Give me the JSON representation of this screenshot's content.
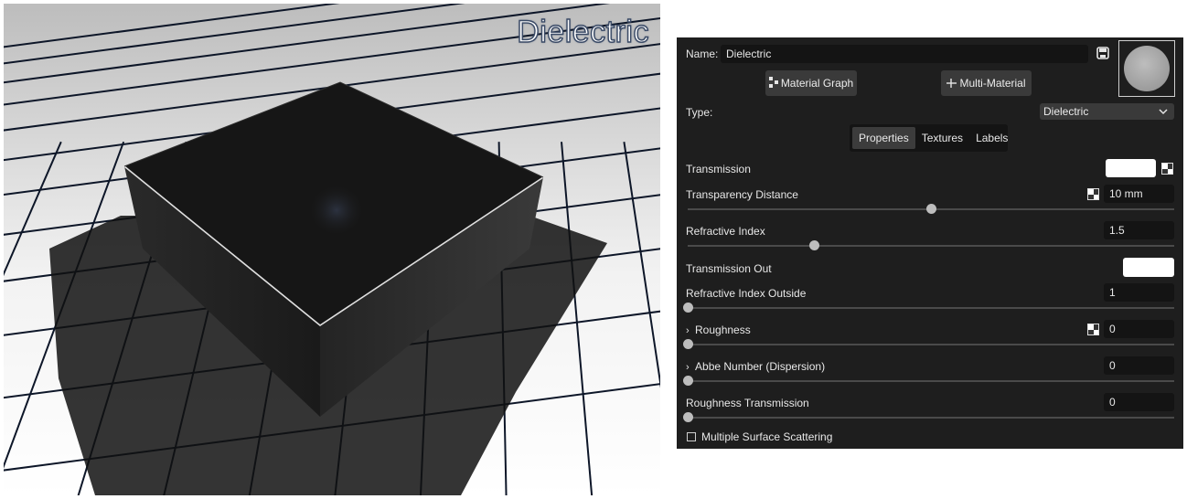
{
  "viewport": {
    "title": "Dielectric"
  },
  "material": {
    "name_label": "Name:",
    "name_value": "Dielectric",
    "material_graph_label": "Material Graph",
    "multi_material_label": "Multi-Material",
    "type_label": "Type:",
    "type_value": "Dielectric",
    "tabs": [
      {
        "label": "Properties",
        "active": true
      },
      {
        "label": "Textures",
        "active": false
      },
      {
        "label": "Labels",
        "active": false
      }
    ]
  },
  "properties": {
    "transmission": {
      "label": "Transmission",
      "color": "#ffffff"
    },
    "transparency_distance": {
      "label": "Transparency Distance",
      "value": "10 mm",
      "slider": 0.5
    },
    "refractive_index": {
      "label": "Refractive Index",
      "value": "1.5",
      "slider": 0.26
    },
    "transmission_out": {
      "label": "Transmission Out",
      "color": "#ffffff"
    },
    "refractive_index_outside": {
      "label": "Refractive Index Outside",
      "value": "1",
      "slider": 0
    },
    "roughness": {
      "label": "Roughness",
      "value": "0",
      "slider": 0
    },
    "abbe_number": {
      "label": "Abbe Number (Dispersion)",
      "value": "0",
      "slider": 0
    },
    "roughness_transmission": {
      "label": "Roughness Transmission",
      "value": "0",
      "slider": 0
    },
    "multiple_surface_scattering": {
      "label": "Multiple Surface Scattering",
      "checked": false
    }
  },
  "icons": {
    "save": "save-icon",
    "material_graph": "graph-icon",
    "multi_material": "multi-material-icon",
    "dropdown": "chevron-down-icon",
    "texture": "checker-texture-icon",
    "expand": "chevron-right-icon"
  }
}
